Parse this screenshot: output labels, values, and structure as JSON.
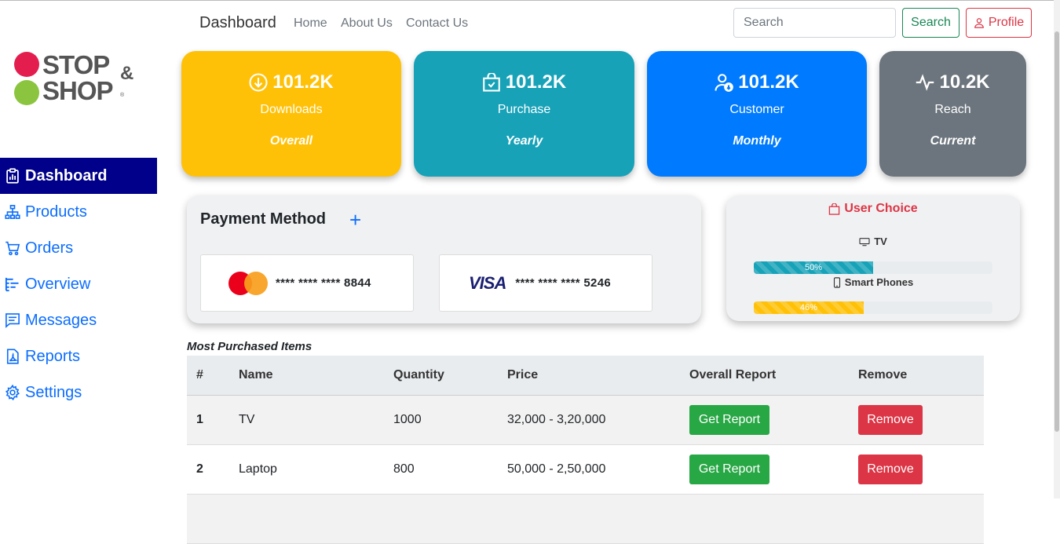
{
  "navbar": {
    "brand": "Dashboard",
    "links": [
      "Home",
      "About Us",
      "Contact Us"
    ],
    "search_placeholder": "Search",
    "search_button": "Search",
    "profile_button": "Profile"
  },
  "logo": {
    "line1": "STOP",
    "line2": "SHOP",
    "amp": "&",
    "reg": "®"
  },
  "sidebar": {
    "items": [
      {
        "label": "Dashboard",
        "icon": "clipboard-data-icon",
        "active": true
      },
      {
        "label": "Products",
        "icon": "diagram-icon"
      },
      {
        "label": "Orders",
        "icon": "cart-icon"
      },
      {
        "label": "Overview",
        "icon": "list-nested-icon"
      },
      {
        "label": "Messages",
        "icon": "message-icon"
      },
      {
        "label": "Reports",
        "icon": "pdf-file-icon"
      },
      {
        "label": "Settings",
        "icon": "gear-icon"
      }
    ]
  },
  "stats": [
    {
      "value": "101.2K",
      "label": "Downloads",
      "period": "Overall",
      "color": "#ffc107",
      "icon": "download-icon"
    },
    {
      "value": "101.2K",
      "label": "Purchase",
      "period": "Yearly",
      "color": "#17a2b8",
      "icon": "bag-check-icon"
    },
    {
      "value": "101.2K",
      "label": "Customer",
      "period": "Monthly",
      "color": "#007bff",
      "icon": "person-down-icon"
    },
    {
      "value": "10.2K",
      "label": "Reach",
      "period": "Current",
      "color": "#6c757d",
      "icon": "activity-icon"
    }
  ],
  "payment": {
    "title": "Payment Method",
    "add": "+",
    "cards": [
      {
        "brand": "mastercard",
        "number": "**** **** **** 8844"
      },
      {
        "brand": "visa",
        "brand_text": "VISA",
        "number": "**** **** **** 5246"
      }
    ]
  },
  "user_choice": {
    "title": "User Choice",
    "items": [
      {
        "label": "TV",
        "icon": "tv-icon",
        "percent": 50,
        "percent_label": "50%",
        "color": "#17a2b8"
      },
      {
        "label": "Smart Phones",
        "icon": "phone-icon",
        "percent": 46,
        "percent_label": "46%",
        "color": "#ffc107"
      }
    ]
  },
  "table": {
    "caption": "Most Purchased Items",
    "headers": [
      "#",
      "Name",
      "Quantity",
      "Price",
      "Overall Report",
      "Remove"
    ],
    "rows": [
      {
        "num": "1",
        "name": "TV",
        "qty": "1000",
        "price": "32,000 - 3,20,000",
        "report": "Get Report",
        "remove": "Remove"
      },
      {
        "num": "2",
        "name": "Laptop",
        "qty": "800",
        "price": "50,000 - 2,50,000",
        "report": "Get Report",
        "remove": "Remove"
      }
    ]
  }
}
